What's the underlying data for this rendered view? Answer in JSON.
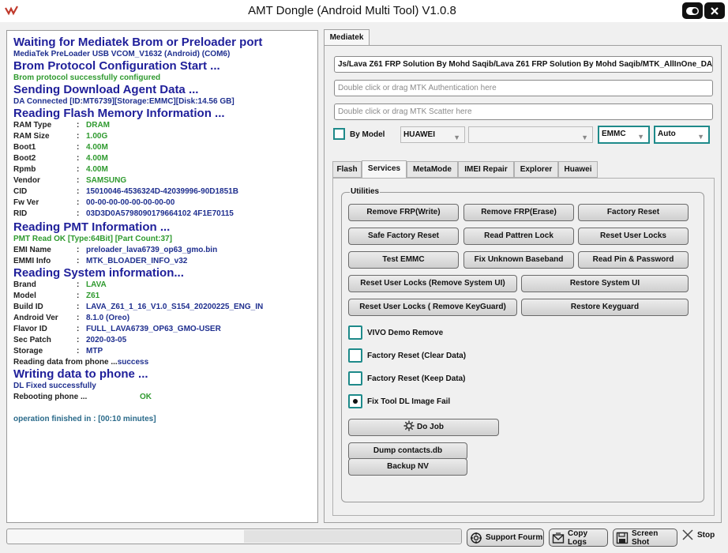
{
  "window": {
    "title": "AMT Dongle (Android Multi Tool) V1.0.8"
  },
  "log": {
    "h1": "Waiting for Mediatek Brom or Preloader port",
    "l1": "MediaTek PreLoader USB VCOM_V1632 (Android) (COM6)",
    "h2": "Brom Protocol Configuration Start ...",
    "l2": "Brom protocol successfully configured",
    "h3": "Sending Download Agent Data ...",
    "l3": "DA Connected [ID:MT6739][Storage:EMMC][Disk:14.56 GB]",
    "h4": "Reading Flash Memory Information ...",
    "flash": [
      {
        "label": "RAM Type",
        "value": "DRAM"
      },
      {
        "label": "RAM Size",
        "value": "1.00G"
      },
      {
        "label": "Boot1",
        "value": "4.00M"
      },
      {
        "label": "Boot2",
        "value": "4.00M"
      },
      {
        "label": "Rpmb",
        "value": "4.00M"
      },
      {
        "label": "Vendor",
        "value": "SAMSUNG"
      },
      {
        "label": "CID",
        "value": "15010046-4536324D-42039996-90D1851B"
      },
      {
        "label": "Fw Ver",
        "value": "00-00-00-00-00-00-00-00"
      },
      {
        "label": "RID",
        "value": "03D3D0A5798090179664102 4F1E70115"
      }
    ],
    "h5": "Reading PMT Information ...",
    "l5": "PMT Read OK [Type:64Bit] [Part Count:37]",
    "pmt": [
      {
        "label": "EMI Name",
        "value": "preloader_lava6739_op63_gmo.bin"
      },
      {
        "label": "EMMI Info",
        "value": "MTK_BLOADER_INFO_v32"
      }
    ],
    "h6": "Reading System information...",
    "sys": [
      {
        "label": "Brand",
        "value": "LAVA"
      },
      {
        "label": "Model",
        "value": "Z61"
      },
      {
        "label": "Build ID",
        "value": "LAVA_Z61_1_16_V1.0_S154_20200225_ENG_IN"
      },
      {
        "label": "Android Ver",
        "value": "8.1.0 (Oreo)"
      },
      {
        "label": "Flavor ID",
        "value": "FULL_LAVA6739_OP63_GMO-USER"
      },
      {
        "label": "Sec Patch",
        "value": "2020-03-05"
      },
      {
        "label": "Storage",
        "value": "MTP"
      }
    ],
    "read_phone": "Reading data from phone ...",
    "read_phone_status": "success",
    "h7": "Writing data to phone ...",
    "l7": "DL Fixed successfully",
    "reboot": "Rebooting phone ...",
    "reboot_status": "OK",
    "finished": "operation finished in : [00:10 minutes]"
  },
  "tabs": {
    "main": "Mediatek"
  },
  "fields": {
    "da_path": "Js/Lava Z61 FRP Solution By Mohd Saqib/Lava Z61 FRP Solution By Mohd Saqib/MTK_AllInOne_DA.bin",
    "auth_placeholder": "Double click or drag MTK Authentication here",
    "scatter_placeholder": "Double click or drag MTK Scatter here"
  },
  "model": {
    "by_model": "By Model",
    "brand": "HUAWEI",
    "model": "",
    "storage": "EMMC",
    "mode": "Auto"
  },
  "subtabs": [
    "Flash",
    "Services",
    "MetaMode",
    "IMEI Repair",
    "Explorer",
    "Huawei"
  ],
  "utilities": {
    "group": "Utilities",
    "buttons": {
      "remove_frp_write": "Remove FRP(Write)",
      "remove_frp_erase": "Remove FRP(Erase)",
      "factory_reset": "Factory Reset",
      "safe_factory_reset": "Safe Factory Reset",
      "read_pattern_lock": "Read Pattren Lock",
      "reset_user_locks": "Reset User Locks",
      "test_emmc": "Test EMMC",
      "fix_unknown_baseband": "Fix Unknown Baseband",
      "read_pin_password": "Read Pin & Password",
      "reset_locks_remove_ui": "Reset User Locks (Remove System UI)",
      "restore_system_ui": "Restore System UI",
      "reset_locks_keyguard": "Reset User Locks ( Remove KeyGuard)",
      "restore_keyguard": "Restore Keyguard"
    },
    "options": {
      "vivo_demo": "VIVO Demo Remove",
      "fr_clear": "Factory Reset (Clear Data)",
      "fr_keep": "Factory Reset (Keep Data)",
      "fix_dl": "Fix Tool DL Image Fail"
    },
    "selected_option": "Fix Tool DL Image Fail",
    "do_job": "Do Job",
    "dump_contacts": "Dump contacts.db",
    "backup_nv": "Backup NV"
  },
  "bottom": {
    "progress": 0,
    "support": "Support Fourm",
    "copy_logs": "Copy Logs",
    "screenshot": "Screen Shot",
    "stop": "Stop"
  },
  "colors": {
    "accent": "#1e8a8a",
    "log_header": "#1f1f9a",
    "log_value": "#2f9a2f",
    "log_info": "#1f2f8f"
  },
  "icons": [
    "app-logo",
    "settings-icon",
    "close-icon",
    "gear-icon",
    "support-icon",
    "mail-icon",
    "save-icon",
    "stop-icon"
  ]
}
